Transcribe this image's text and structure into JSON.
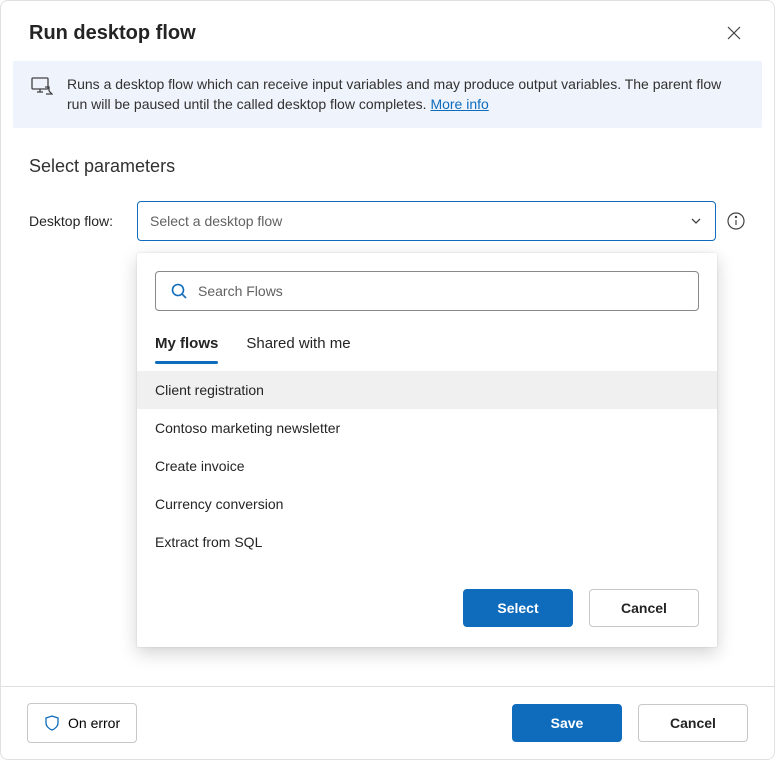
{
  "dialog": {
    "title": "Run desktop flow",
    "banner_text": "Runs a desktop flow which can receive input variables and may produce output variables. The parent flow run will be paused until the called desktop flow completes. ",
    "more_info": "More info"
  },
  "section": {
    "title": "Select parameters",
    "field_label": "Desktop flow:",
    "dropdown_placeholder": "Select a desktop flow"
  },
  "panel": {
    "search_placeholder": "Search Flows",
    "tabs": {
      "my_flows": "My flows",
      "shared": "Shared with me"
    },
    "flows": [
      "Client registration",
      "Contoso marketing newsletter",
      "Create invoice",
      "Currency conversion",
      "Extract from SQL"
    ],
    "select_label": "Select",
    "cancel_label": "Cancel"
  },
  "footer": {
    "on_error": "On error",
    "save": "Save",
    "cancel": "Cancel"
  },
  "colors": {
    "accent": "#0f6cbd"
  }
}
